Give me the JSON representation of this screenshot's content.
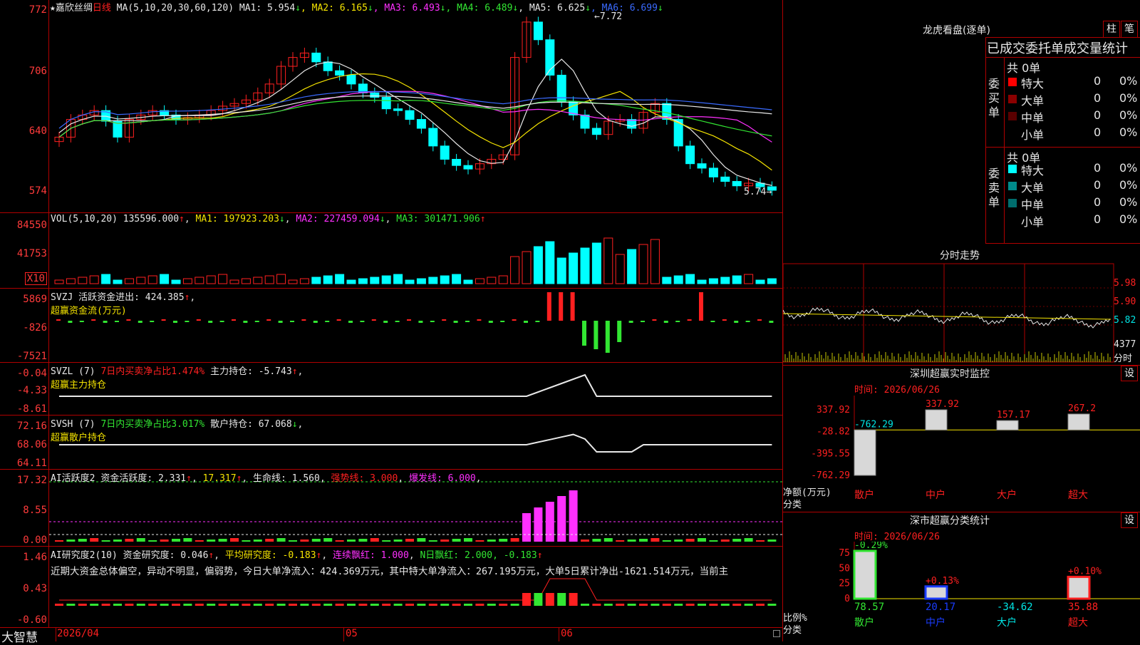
{
  "stock": {
    "name": "★嘉欣丝绸",
    "period": "日线"
  },
  "main_header": {
    "ma_def": "MA(5,10,20,30,60,120)",
    "items": [
      {
        "label": "MA1:",
        "value": "5.954",
        "arrow": "↓",
        "color": "#e8e8e8"
      },
      {
        "label": "MA2:",
        "value": "6.165",
        "arrow": "↓",
        "color": "#f5e400"
      },
      {
        "label": "MA3:",
        "value": "6.493",
        "arrow": "↓",
        "color": "#ff30ff"
      },
      {
        "label": "MA4:",
        "value": "6.489",
        "arrow": "↓",
        "color": "#32e632"
      },
      {
        "label": "MA5:",
        "value": "6.625",
        "arrow": "↓",
        "color": "#e8e8e8"
      },
      {
        "label": "MA6:",
        "value": "6.699",
        "arrow": "↓",
        "color": "#3a6bff"
      }
    ]
  },
  "main_axis": [
    "772",
    "706",
    "640",
    "574"
  ],
  "price_marks": {
    "high": "7.72",
    "low": "5.74"
  },
  "vol": {
    "label": "VOL(5,10,20)",
    "value": "135596.000",
    "arrow": "↑",
    "ma1": "MA1: 197923.203",
    "ma1_arrow": "↓",
    "ma2": "MA2: 227459.094",
    "ma2_arrow": "↓",
    "ma3": "MA3: 301471.906",
    "ma3_arrow": "↑",
    "axis": [
      "84550",
      "41753"
    ],
    "unit": "X10"
  },
  "svzj": {
    "label": "SVZJ",
    "title": "活跃资金进出: 424.385",
    "arrow": "↑",
    "sub": "超赢资金流(万元)",
    "axis": [
      "5869",
      "-826",
      "-7521"
    ]
  },
  "svzl": {
    "label": "SVZL (7)",
    "pct": "7日内买卖净占比1.474%",
    "title": "主力持仓: -5.743",
    "arrow": "↑",
    "sub": "超赢主力持仓",
    "axis": [
      "-0.04",
      "-4.33",
      "-8.61"
    ]
  },
  "svsh": {
    "label": "SVSH (7)",
    "pct": "7日内买卖净占比3.017%",
    "title": "散户持仓: 67.068",
    "arrow": "↓",
    "sub": "超赢散户持仓",
    "axis": [
      "72.16",
      "68.06",
      "64.11"
    ]
  },
  "ai_act": {
    "label": "AI活跃度2",
    "title": "资金活跃度: 2.331",
    "v2": "17.317",
    "life": "生命线: 1.560",
    "strong": "强势线: 3.000",
    "burst": "爆发线: 6.000",
    "axis": [
      "17.32",
      "8.55",
      "0.00"
    ]
  },
  "ai_res": {
    "label": "AI研究度2(10)",
    "title": "资金研究度: 0.046",
    "avg": "平均研究度: -0.183",
    "lianxu": "连续飘红: 1.000",
    "nday": "N日飘红: 2.000, -0.183",
    "comment": "近期大资金总体偏空，异动不明显，偏弱势，今日大单净流入：424.369万元，其中特大单净流入：267.195万元，大单5日累计净出-1621.514万元，当前主",
    "axis": [
      "1.46",
      "0.43",
      "-0.60"
    ]
  },
  "bottom": {
    "brand": "大智慧",
    "date": "2026/04",
    "month1": "05",
    "month2": "06"
  },
  "lhb": {
    "title": "龙虎看盘(逐单)",
    "btn1": "柱",
    "btn2": "笔",
    "head": "已成交委托单成交量统计",
    "buy": {
      "side": "委买单",
      "total": "共 0单",
      "rows": [
        {
          "name": "特大",
          "val": "0",
          "pct": "0%",
          "color": "#ff0000"
        },
        {
          "name": "大单",
          "val": "0",
          "pct": "0%",
          "color": "#8b0000"
        },
        {
          "name": "中单",
          "val": "0",
          "pct": "0%",
          "color": "#5a0000"
        },
        {
          "name": "小单",
          "val": "0",
          "pct": "0%",
          "color": "#000000"
        }
      ]
    },
    "sell": {
      "side": "委卖单",
      "total": "共 0单",
      "rows": [
        {
          "name": "特大",
          "val": "0",
          "pct": "0%",
          "color": "#00ffff"
        },
        {
          "name": "大单",
          "val": "0",
          "pct": "0%",
          "color": "#008b8b"
        },
        {
          "name": "中单",
          "val": "0",
          "pct": "0%",
          "color": "#006d6d"
        },
        {
          "name": "小单",
          "val": "0",
          "pct": "0%",
          "color": "#000000"
        }
      ]
    }
  },
  "intraday": {
    "title": "分时走势",
    "axis": [
      "5.98",
      "5.90",
      "5.82"
    ],
    "vol_label": "4377",
    "vol_unit": "分时"
  },
  "monitor": {
    "title": "深圳超赢实时监控",
    "btn": "设",
    "time": "时间: 2026/06/26",
    "axis": [
      "337.92",
      "-28.82",
      "-395.55",
      "-762.29"
    ],
    "ylabel": "净额(万元)",
    "xlabel": "分类",
    "chart_data": {
      "type": "bar",
      "categories": [
        "散户",
        "中户",
        "大户",
        "超大"
      ],
      "values": [
        -762.29,
        337.92,
        157.17,
        267.2
      ],
      "value_labels": [
        "-762.29",
        "337.92",
        "157.17",
        "267.2"
      ],
      "ylim": [
        -762.29,
        337.92
      ]
    }
  },
  "stats": {
    "title": "深市超赢分类统计",
    "btn": "设",
    "time": "时间: 2026/06/26",
    "axis": [
      "75",
      "50",
      "25",
      "0"
    ],
    "ylabel": "比例%",
    "xlabel": "分类",
    "chart_data": {
      "type": "bar",
      "categories": [
        "散户",
        "中户",
        "大户",
        "超大"
      ],
      "values": [
        78.57,
        20.17,
        -34.62,
        35.88
      ],
      "value_labels": [
        "78.57",
        "20.17",
        "-34.62",
        "35.88"
      ],
      "change_labels": [
        "-0.29%",
        "+0.13%",
        "",
        "+0.10%"
      ],
      "ylim": [
        0,
        75
      ]
    }
  }
}
